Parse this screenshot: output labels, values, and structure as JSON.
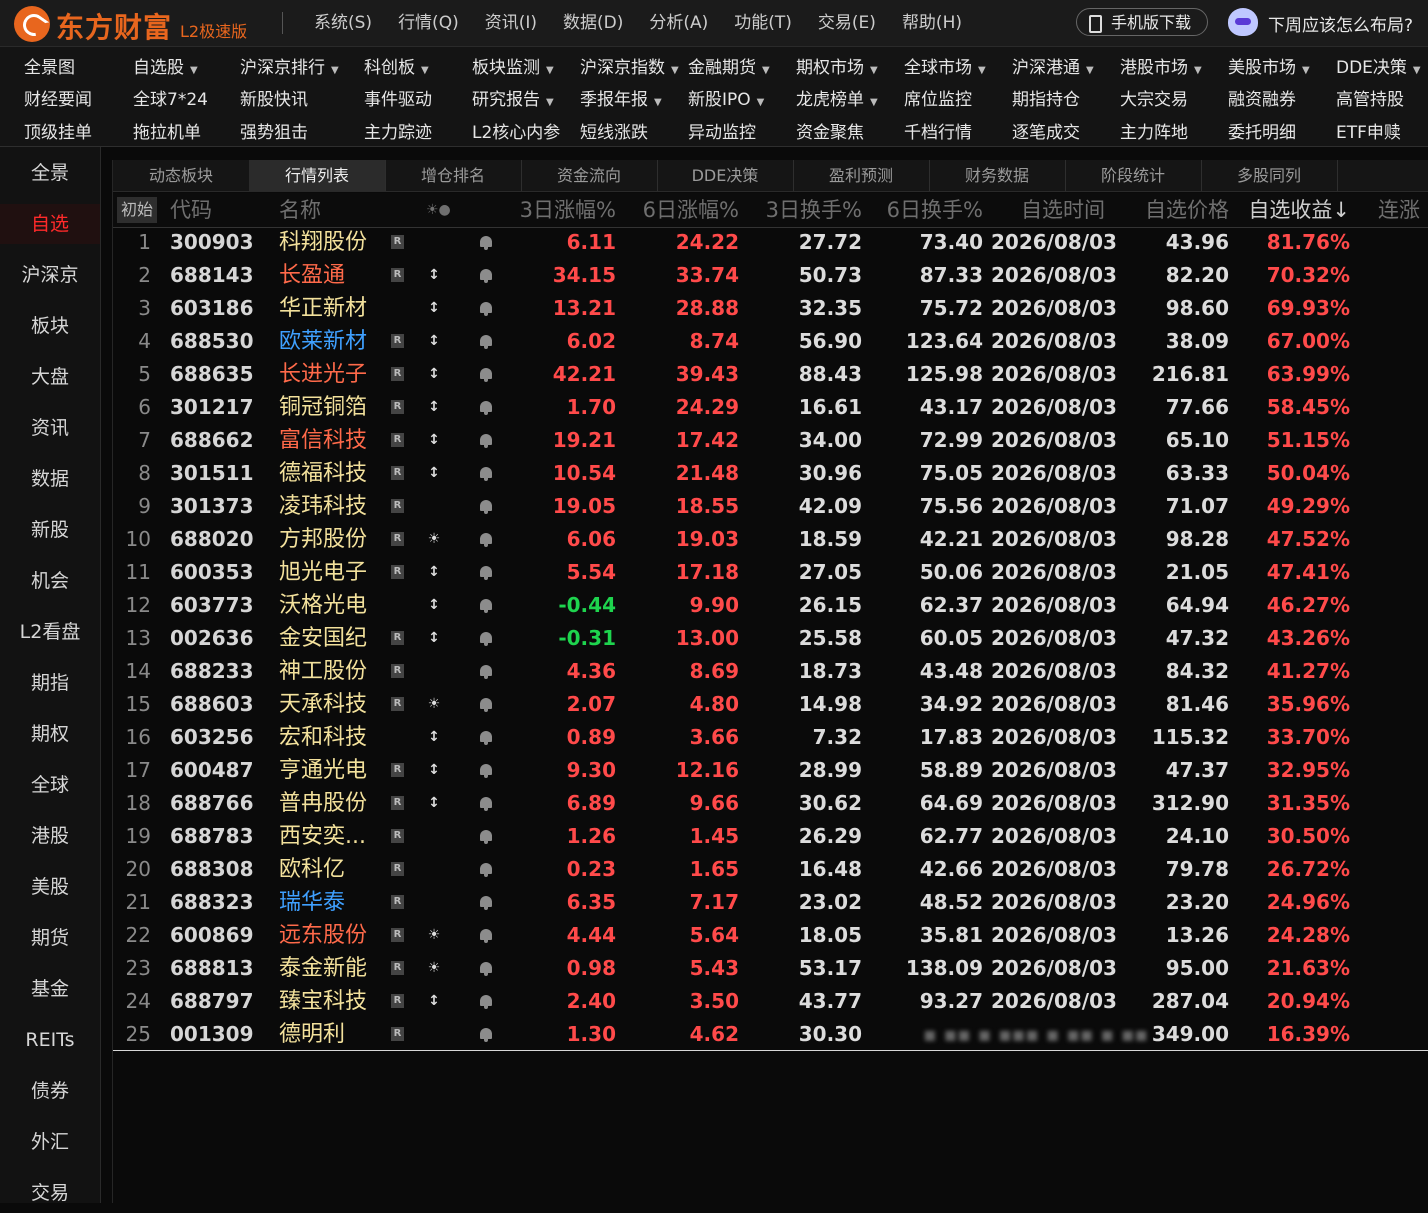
{
  "app": {
    "name": "东方财富",
    "edition": "L2极速版"
  },
  "menu": [
    "系统(S)",
    "行情(Q)",
    "资讯(I)",
    "数据(D)",
    "分析(A)",
    "功能(T)",
    "交易(E)",
    "帮助(H)"
  ],
  "mobile_button": "手机版下载",
  "assistant_prompt": "下周应该怎么布局?",
  "nav_rows": [
    [
      {
        "label": "全景图",
        "dropdown": false
      },
      {
        "label": "自选股",
        "dropdown": true
      },
      {
        "label": "沪深京排行",
        "dropdown": true
      },
      {
        "label": "科创板",
        "dropdown": true
      },
      {
        "label": "板块监测",
        "dropdown": true
      },
      {
        "label": "沪深京指数",
        "dropdown": true
      },
      {
        "label": "金融期货",
        "dropdown": true
      },
      {
        "label": "期权市场",
        "dropdown": true
      },
      {
        "label": "全球市场",
        "dropdown": true
      },
      {
        "label": "沪深港通",
        "dropdown": true
      },
      {
        "label": "港股市场",
        "dropdown": true
      },
      {
        "label": "美股市场",
        "dropdown": true
      },
      {
        "label": "DDE决策",
        "dropdown": true
      }
    ],
    [
      {
        "label": "财经要闻",
        "dropdown": false
      },
      {
        "label": "全球7*24",
        "dropdown": false
      },
      {
        "label": "新股快讯",
        "dropdown": false
      },
      {
        "label": "事件驱动",
        "dropdown": false
      },
      {
        "label": "研究报告",
        "dropdown": true
      },
      {
        "label": "季报年报",
        "dropdown": true
      },
      {
        "label": "新股IPO",
        "dropdown": true
      },
      {
        "label": "龙虎榜单",
        "dropdown": true
      },
      {
        "label": "席位监控",
        "dropdown": false
      },
      {
        "label": "期指持仓",
        "dropdown": false
      },
      {
        "label": "大宗交易",
        "dropdown": false
      },
      {
        "label": "融资融券",
        "dropdown": false
      },
      {
        "label": "高管持股",
        "dropdown": false
      }
    ],
    [
      {
        "label": "顶级挂单",
        "dropdown": false
      },
      {
        "label": "拖拉机单",
        "dropdown": false
      },
      {
        "label": "强势狙击",
        "dropdown": false
      },
      {
        "label": "主力踪迹",
        "dropdown": false
      },
      {
        "label": "L2核心内参",
        "dropdown": false
      },
      {
        "label": "短线涨跌",
        "dropdown": false
      },
      {
        "label": "异动监控",
        "dropdown": false
      },
      {
        "label": "资金聚焦",
        "dropdown": false
      },
      {
        "label": "千档行情",
        "dropdown": false
      },
      {
        "label": "逐笔成交",
        "dropdown": false
      },
      {
        "label": "主力阵地",
        "dropdown": false
      },
      {
        "label": "委托明细",
        "dropdown": false
      },
      {
        "label": "ETF申赎",
        "dropdown": false
      }
    ]
  ],
  "sidebar": [
    "全景",
    "自选",
    "沪深京",
    "板块",
    "大盘",
    "资讯",
    "数据",
    "新股",
    "机会",
    "L2看盘",
    "期指",
    "期权",
    "全球",
    "港股",
    "美股",
    "期货",
    "基金",
    "REITs",
    "债券",
    "外汇",
    "交易"
  ],
  "sidebar_active": 1,
  "tabs": [
    "动态板块",
    "行情列表",
    "增仓排名",
    "资金流向",
    "DDE决策",
    "盈利预测",
    "财务数据",
    "阶段统计",
    "多股同列"
  ],
  "tab_active": 1,
  "columns": {
    "init_button": "初始",
    "code": "代码",
    "name": "名称",
    "flags": "☀●",
    "pct3": "3日涨幅%",
    "pct6": "6日涨幅%",
    "turn3": "3日换手%",
    "turn6": "6日换手%",
    "date": "自选时间",
    "price": "自选价格",
    "gain": "自选收益↓",
    "streak": "连涨"
  },
  "colors": {
    "up": "#ff4a4a",
    "down": "#1ed44e",
    "name_default": "#f3e19c",
    "name_blue": "#3fa0ff",
    "name_red": "#ff6a4a",
    "accent": "#e8661e"
  },
  "rows": [
    {
      "n": "1",
      "code": "300903",
      "name": "科翔股份",
      "r": true,
      "flag": "",
      "p3": "6.11",
      "p6": "24.22",
      "t3": "27.72",
      "t6": "73.40",
      "date": "2026/08/03",
      "price": "43.96",
      "gain": "81.76%",
      "name_color": "default"
    },
    {
      "n": "2",
      "code": "688143",
      "name": "长盈通",
      "r": true,
      "flag": "↕",
      "p3": "34.15",
      "p6": "33.74",
      "t3": "50.73",
      "t6": "87.33",
      "date": "2026/08/03",
      "price": "82.20",
      "gain": "70.32%",
      "name_color": "red"
    },
    {
      "n": "3",
      "code": "603186",
      "name": "华正新材",
      "r": false,
      "flag": "↕",
      "p3": "13.21",
      "p6": "28.88",
      "t3": "32.35",
      "t6": "75.72",
      "date": "2026/08/03",
      "price": "98.60",
      "gain": "69.93%",
      "name_color": "default"
    },
    {
      "n": "4",
      "code": "688530",
      "name": "欧莱新材",
      "r": true,
      "flag": "↕",
      "p3": "6.02",
      "p6": "8.74",
      "t3": "56.90",
      "t6": "123.64",
      "date": "2026/08/03",
      "price": "38.09",
      "gain": "67.00%",
      "name_color": "blue"
    },
    {
      "n": "5",
      "code": "688635",
      "name": "长进光子",
      "r": true,
      "flag": "↕",
      "p3": "42.21",
      "p6": "39.43",
      "t3": "88.43",
      "t6": "125.98",
      "date": "2026/08/03",
      "price": "216.81",
      "gain": "63.99%",
      "name_color": "red"
    },
    {
      "n": "6",
      "code": "301217",
      "name": "铜冠铜箔",
      "r": true,
      "flag": "↕",
      "p3": "1.70",
      "p6": "24.29",
      "t3": "16.61",
      "t6": "43.17",
      "date": "2026/08/03",
      "price": "77.66",
      "gain": "58.45%",
      "name_color": "default"
    },
    {
      "n": "7",
      "code": "688662",
      "name": "富信科技",
      "r": true,
      "flag": "↕",
      "p3": "19.21",
      "p6": "17.42",
      "t3": "34.00",
      "t6": "72.99",
      "date": "2026/08/03",
      "price": "65.10",
      "gain": "51.15%",
      "name_color": "red"
    },
    {
      "n": "8",
      "code": "301511",
      "name": "德福科技",
      "r": true,
      "flag": "↕",
      "p3": "10.54",
      "p6": "21.48",
      "t3": "30.96",
      "t6": "75.05",
      "date": "2026/08/03",
      "price": "63.33",
      "gain": "50.04%",
      "name_color": "default"
    },
    {
      "n": "9",
      "code": "301373",
      "name": "凌玮科技",
      "r": true,
      "flag": "",
      "p3": "19.05",
      "p6": "18.55",
      "t3": "42.09",
      "t6": "75.56",
      "date": "2026/08/03",
      "price": "71.07",
      "gain": "49.29%",
      "name_color": "default"
    },
    {
      "n": "10",
      "code": "688020",
      "name": "方邦股份",
      "r": true,
      "flag": "☀",
      "p3": "6.06",
      "p6": "19.03",
      "t3": "18.59",
      "t6": "42.21",
      "date": "2026/08/03",
      "price": "98.28",
      "gain": "47.52%",
      "name_color": "default"
    },
    {
      "n": "11",
      "code": "600353",
      "name": "旭光电子",
      "r": true,
      "flag": "↕",
      "p3": "5.54",
      "p6": "17.18",
      "t3": "27.05",
      "t6": "50.06",
      "date": "2026/08/03",
      "price": "21.05",
      "gain": "47.41%",
      "name_color": "default"
    },
    {
      "n": "12",
      "code": "603773",
      "name": "沃格光电",
      "r": false,
      "flag": "↕",
      "p3": "-0.44",
      "p6": "9.90",
      "t3": "26.15",
      "t6": "62.37",
      "date": "2026/08/03",
      "price": "64.94",
      "gain": "46.27%",
      "name_color": "default"
    },
    {
      "n": "13",
      "code": "002636",
      "name": "金安国纪",
      "r": true,
      "flag": "↕",
      "p3": "-0.31",
      "p6": "13.00",
      "t3": "25.58",
      "t6": "60.05",
      "date": "2026/08/03",
      "price": "47.32",
      "gain": "43.26%",
      "name_color": "default"
    },
    {
      "n": "14",
      "code": "688233",
      "name": "神工股份",
      "r": true,
      "flag": "",
      "p3": "4.36",
      "p6": "8.69",
      "t3": "18.73",
      "t6": "43.48",
      "date": "2026/08/03",
      "price": "84.32",
      "gain": "41.27%",
      "name_color": "default"
    },
    {
      "n": "15",
      "code": "688603",
      "name": "天承科技",
      "r": true,
      "flag": "☀",
      "p3": "2.07",
      "p6": "4.80",
      "t3": "14.98",
      "t6": "34.92",
      "date": "2026/08/03",
      "price": "81.46",
      "gain": "35.96%",
      "name_color": "default"
    },
    {
      "n": "16",
      "code": "603256",
      "name": "宏和科技",
      "r": false,
      "flag": "↕",
      "p3": "0.89",
      "p6": "3.66",
      "t3": "7.32",
      "t6": "17.83",
      "date": "2026/08/03",
      "price": "115.32",
      "gain": "33.70%",
      "name_color": "default"
    },
    {
      "n": "17",
      "code": "600487",
      "name": "亨通光电",
      "r": true,
      "flag": "↕",
      "p3": "9.30",
      "p6": "12.16",
      "t3": "28.99",
      "t6": "58.89",
      "date": "2026/08/03",
      "price": "47.37",
      "gain": "32.95%",
      "name_color": "default"
    },
    {
      "n": "18",
      "code": "688766",
      "name": "普冉股份",
      "r": true,
      "flag": "↕",
      "p3": "6.89",
      "p6": "9.66",
      "t3": "30.62",
      "t6": "64.69",
      "date": "2026/08/03",
      "price": "312.90",
      "gain": "31.35%",
      "name_color": "default"
    },
    {
      "n": "19",
      "code": "688783",
      "name": "西安奕...",
      "r": true,
      "flag": "",
      "p3": "1.26",
      "p6": "1.45",
      "t3": "26.29",
      "t6": "62.77",
      "date": "2026/08/03",
      "price": "24.10",
      "gain": "30.50%",
      "name_color": "default"
    },
    {
      "n": "20",
      "code": "688308",
      "name": "欧科亿",
      "r": true,
      "flag": "",
      "p3": "0.23",
      "p6": "1.65",
      "t3": "16.48",
      "t6": "42.66",
      "date": "2026/08/03",
      "price": "79.78",
      "gain": "26.72%",
      "name_color": "default"
    },
    {
      "n": "21",
      "code": "688323",
      "name": "瑞华泰",
      "r": true,
      "flag": "",
      "p3": "6.35",
      "p6": "7.17",
      "t3": "23.02",
      "t6": "48.52",
      "date": "2026/08/03",
      "price": "23.20",
      "gain": "24.96%",
      "name_color": "blue"
    },
    {
      "n": "22",
      "code": "600869",
      "name": "远东股份",
      "r": true,
      "flag": "☀",
      "p3": "4.44",
      "p6": "5.64",
      "t3": "18.05",
      "t6": "35.81",
      "date": "2026/08/03",
      "price": "13.26",
      "gain": "24.28%",
      "name_color": "red"
    },
    {
      "n": "23",
      "code": "688813",
      "name": "泰金新能",
      "r": true,
      "flag": "☀",
      "p3": "0.98",
      "p6": "5.43",
      "t3": "53.17",
      "t6": "138.09",
      "date": "2026/08/03",
      "price": "95.00",
      "gain": "21.63%",
      "name_color": "default"
    },
    {
      "n": "24",
      "code": "688797",
      "name": "臻宝科技",
      "r": true,
      "flag": "↕",
      "p3": "2.40",
      "p6": "3.50",
      "t3": "43.77",
      "t6": "93.27",
      "date": "2026/08/03",
      "price": "287.04",
      "gain": "20.94%",
      "name_color": "default"
    },
    {
      "n": "25",
      "code": "001309",
      "name": "德明利",
      "r": true,
      "flag": "",
      "p3": "1.30",
      "p6": "4.62",
      "t3": "30.30",
      "t6": "",
      "date": "",
      "price": "349.00",
      "gain": "16.39%",
      "name_color": "default",
      "blurred": true
    }
  ]
}
